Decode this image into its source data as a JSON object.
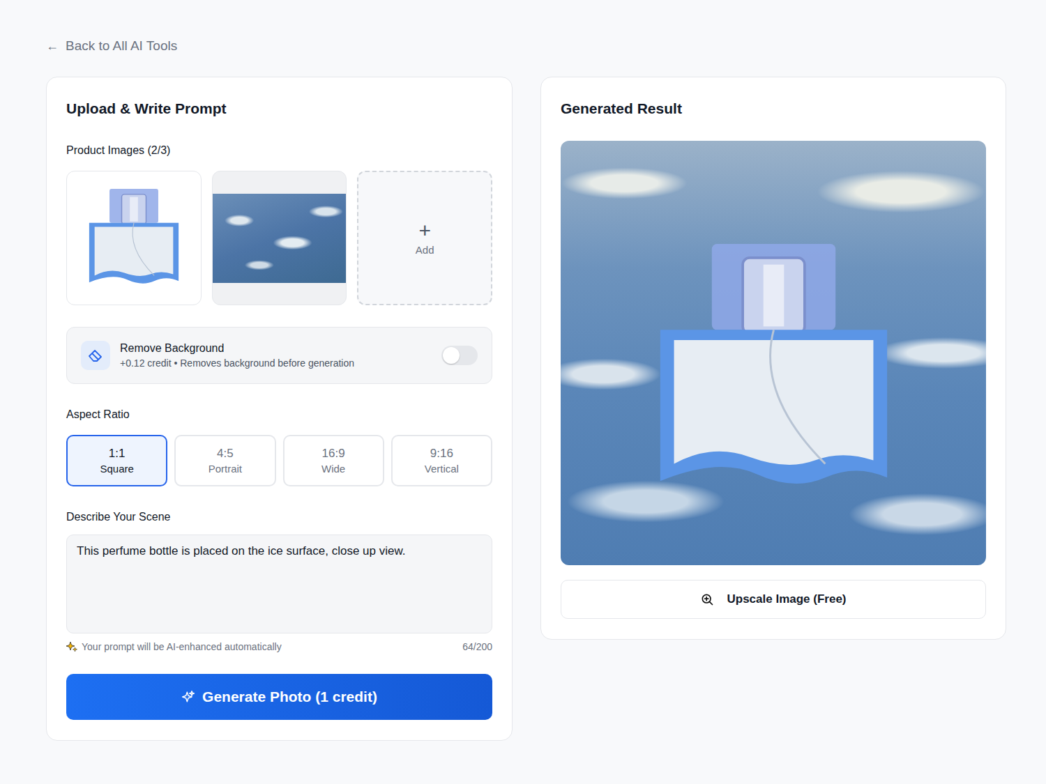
{
  "back_link": {
    "icon": "←",
    "label": "Back to All AI Tools"
  },
  "upload_panel": {
    "title": "Upload & Write Prompt",
    "images_label": "Product Images (2/3)",
    "images": [
      {
        "kind": "product"
      },
      {
        "kind": "texture"
      }
    ],
    "add_tile": {
      "icon": "+",
      "label": "Add"
    },
    "remove_background": {
      "title": "Remove Background",
      "subtitle": "+0.12 credit • Removes background before generation",
      "on": false
    },
    "aspect_ratio": {
      "label": "Aspect Ratio",
      "options": [
        {
          "ratio": "1:1",
          "label": "Square",
          "selected": true
        },
        {
          "ratio": "4:5",
          "label": "Portrait",
          "selected": false
        },
        {
          "ratio": "16:9",
          "label": "Wide",
          "selected": false
        },
        {
          "ratio": "9:16",
          "label": "Vertical",
          "selected": false
        }
      ]
    },
    "scene": {
      "label": "Describe Your Scene",
      "value": "This perfume bottle is placed on the ice surface, close up view.",
      "hint": "Your prompt will be AI-enhanced automatically",
      "count": "64/200"
    },
    "generate_button": {
      "label": "Generate Photo (1 credit)"
    }
  },
  "result_panel": {
    "title": "Generated Result",
    "upscale_button": {
      "label": "Upscale Image (Free)"
    }
  }
}
